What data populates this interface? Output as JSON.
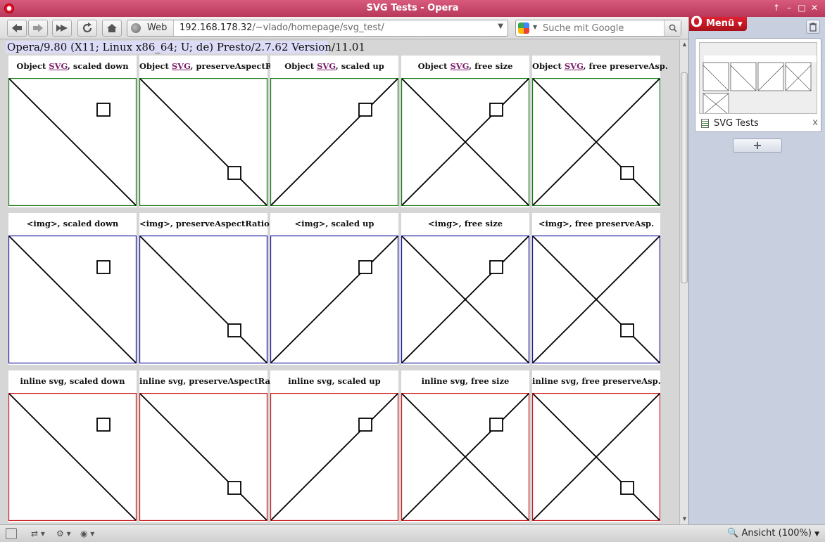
{
  "window": {
    "title": "SVG Tests - Opera",
    "controls": [
      "↑",
      "–",
      "□",
      "✕"
    ]
  },
  "toolbar": {
    "back_icon": "back-arrow-icon",
    "forward_icon": "forward-arrow-icon",
    "fastforward_icon": "fast-forward-icon",
    "reload_icon": "reload-icon",
    "home_icon": "home-icon",
    "address": {
      "badge": "Web",
      "host": "192.168.178.32",
      "path": "/~vlado/homepage/svg_test/"
    },
    "search": {
      "placeholder": "Suche mit Google"
    }
  },
  "page": {
    "user_agent": "Opera/9.80 (X11; Linux x86_64; U; de) Presto/2.7.62 Version/11.01",
    "rows": [
      {
        "color": "#1a7a1a",
        "cells": [
          {
            "prefix": "Object ",
            "link": "SVG",
            "suffix": ", scaled down",
            "variant": "down"
          },
          {
            "prefix": "Object ",
            "link": "SVG",
            "suffix": ", preserveAspectRatio",
            "variant": "preserve"
          },
          {
            "prefix": "Object ",
            "link": "SVG",
            "suffix": ", scaled up",
            "variant": "up"
          },
          {
            "prefix": "Object ",
            "link": "SVG",
            "suffix": ", free size",
            "variant": "free"
          },
          {
            "prefix": "Object ",
            "link": "SVG",
            "suffix": ", free preserveAsp.",
            "variant": "freepreserve"
          }
        ]
      },
      {
        "color": "#1a1aa0",
        "cells": [
          {
            "prefix": "<img>, scaled down",
            "link": "",
            "suffix": "",
            "variant": "down"
          },
          {
            "prefix": "<img>, preserveAspectRatio",
            "link": "",
            "suffix": "",
            "variant": "preserve"
          },
          {
            "prefix": "<img>, scaled up",
            "link": "",
            "suffix": "",
            "variant": "up"
          },
          {
            "prefix": "<img>, free size",
            "link": "",
            "suffix": "",
            "variant": "free"
          },
          {
            "prefix": "<img>, free preserveAsp.",
            "link": "",
            "suffix": "",
            "variant": "freepreserve"
          }
        ]
      },
      {
        "color": "#cc1a1a",
        "cells": [
          {
            "prefix": "inline svg, scaled down",
            "link": "",
            "suffix": "",
            "variant": "down"
          },
          {
            "prefix": "inline svg, preserveAspectRatio",
            "link": "",
            "suffix": "",
            "variant": "preserve"
          },
          {
            "prefix": "inline svg, scaled up",
            "link": "",
            "suffix": "",
            "variant": "up"
          },
          {
            "prefix": "inline svg, free size",
            "link": "",
            "suffix": "",
            "variant": "free"
          },
          {
            "prefix": "inline svg, free preserveAsp.",
            "link": "",
            "suffix": "",
            "variant": "freepreserve"
          }
        ]
      }
    ]
  },
  "panel": {
    "menu_label": "Menü",
    "tab_title": "SVG Tests",
    "close_glyph": "x",
    "new_tab_glyph": "+"
  },
  "statusbar": {
    "zoom_label": "Ansicht (100%)"
  }
}
